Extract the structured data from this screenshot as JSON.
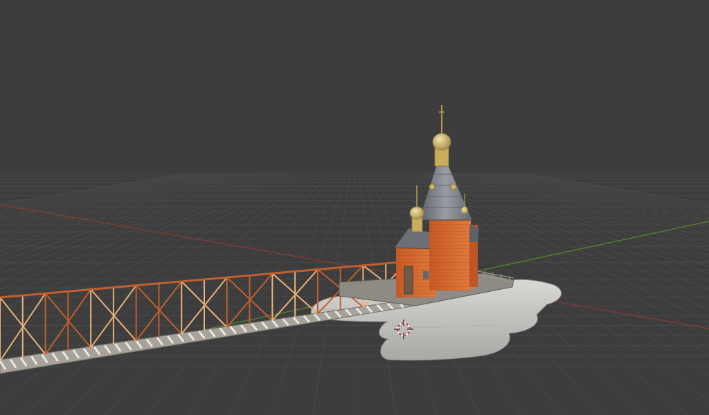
{
  "viewport": {
    "mode": "3d-viewport",
    "background_color": "#3d3d3d",
    "grid_color": "#484848",
    "x_axis_color": "#9a3b3b",
    "y_axis_color": "#5d8a2a"
  },
  "scene": {
    "objects": [
      {
        "name": "church",
        "icon": "church-model"
      },
      {
        "name": "bridge",
        "icon": "truss-bridge-model"
      },
      {
        "name": "rock-island",
        "icon": "rock-base-model"
      },
      {
        "name": "3d-cursor",
        "icon": "3d-cursor-icon"
      }
    ],
    "colors": {
      "brick": "#d96a2e",
      "brick_dark": "#b5511f",
      "roof": "#7c7f86",
      "gold": "#cdb56a",
      "rock": "#c8c8c4",
      "truss_light": "#e8b27a",
      "truss_dark": "#c0602f"
    }
  }
}
